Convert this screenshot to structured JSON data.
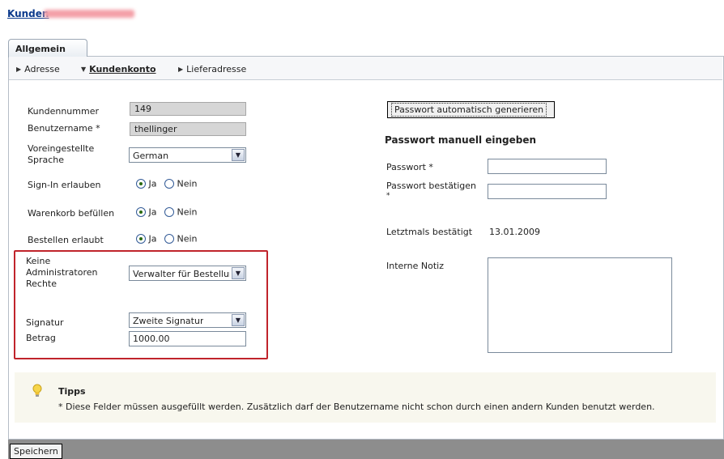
{
  "header": {
    "title": "Kunden"
  },
  "tabs": [
    {
      "label": "Allgemein"
    }
  ],
  "subnav": [
    {
      "label": "Adresse"
    },
    {
      "label": "Kundenkonto"
    },
    {
      "label": "Lieferadresse"
    }
  ],
  "form": {
    "kundennummer": {
      "label": "Kundennummer",
      "value": "149"
    },
    "benutzername": {
      "label": "Benutzername *",
      "value": "thellinger"
    },
    "sprache": {
      "label1": "Voreingestellte",
      "label2": "Sprache",
      "value": "German"
    },
    "signin": {
      "label": "Sign-In erlauben",
      "yes": "Ja",
      "no": "Nein"
    },
    "warenkorb": {
      "label": "Warenkorb befüllen",
      "yes": "Ja",
      "no": "Nein"
    },
    "bestellen": {
      "label": "Bestellen erlaubt",
      "yes": "Ja",
      "no": "Nein"
    },
    "admin": {
      "label1": "Keine",
      "label2": "Administratoren",
      "label3": "Rechte",
      "value": "Verwalter für Bestellungen"
    },
    "signatur": {
      "label": "Signatur",
      "value": "Zweite Signatur"
    },
    "betrag": {
      "label": "Betrag",
      "value": "1000.00"
    }
  },
  "password": {
    "generate_label": "Passwort automatisch generieren",
    "manual_heading": "Passwort manuell eingeben",
    "password_label": "Passwort *",
    "confirm_label": "Passwort bestätigen",
    "confirm_star": "*",
    "last_confirmed_label": "Letztmals bestätigt",
    "last_confirmed_value": "13.01.2009",
    "note_label": "Interne Notiz"
  },
  "tips": {
    "title": "Tipps",
    "text": "* Diese Felder müssen ausgefüllt werden. Zusätzlich darf der Benutzername nicht schon durch einen andern Kunden benutzt werden."
  },
  "footer": {
    "save_label": "Speichern"
  }
}
